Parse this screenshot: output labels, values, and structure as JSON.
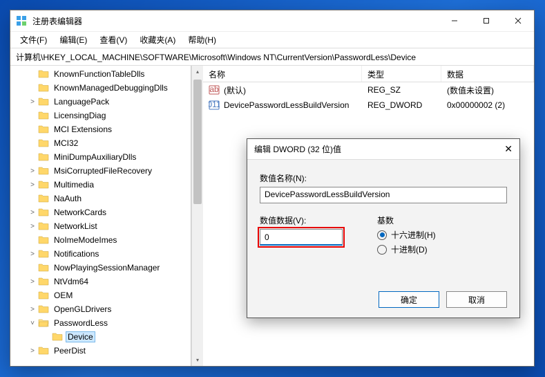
{
  "window": {
    "title": "注册表编辑器"
  },
  "menubar": {
    "items": [
      "文件(F)",
      "编辑(E)",
      "查看(V)",
      "收藏夹(A)",
      "帮助(H)"
    ]
  },
  "address": "计算机\\HKEY_LOCAL_MACHINE\\SOFTWARE\\Microsoft\\Windows NT\\CurrentVersion\\PasswordLess\\Device",
  "tree": {
    "items": [
      {
        "label": "KnownFunctionTableDlls",
        "depth": 1,
        "expander": ""
      },
      {
        "label": "KnownManagedDebuggingDlls",
        "depth": 1,
        "expander": ""
      },
      {
        "label": "LanguagePack",
        "depth": 1,
        "expander": ">"
      },
      {
        "label": "LicensingDiag",
        "depth": 1,
        "expander": ""
      },
      {
        "label": "MCI Extensions",
        "depth": 1,
        "expander": ""
      },
      {
        "label": "MCI32",
        "depth": 1,
        "expander": ""
      },
      {
        "label": "MiniDumpAuxiliaryDlls",
        "depth": 1,
        "expander": ""
      },
      {
        "label": "MsiCorruptedFileRecovery",
        "depth": 1,
        "expander": ">"
      },
      {
        "label": "Multimedia",
        "depth": 1,
        "expander": ">"
      },
      {
        "label": "NaAuth",
        "depth": 1,
        "expander": ""
      },
      {
        "label": "NetworkCards",
        "depth": 1,
        "expander": ">"
      },
      {
        "label": "NetworkList",
        "depth": 1,
        "expander": ">"
      },
      {
        "label": "NoImeModeImes",
        "depth": 1,
        "expander": ""
      },
      {
        "label": "Notifications",
        "depth": 1,
        "expander": ">"
      },
      {
        "label": "NowPlayingSessionManager",
        "depth": 1,
        "expander": ""
      },
      {
        "label": "NtVdm64",
        "depth": 1,
        "expander": ">"
      },
      {
        "label": "OEM",
        "depth": 1,
        "expander": ""
      },
      {
        "label": "OpenGLDrivers",
        "depth": 1,
        "expander": ">"
      },
      {
        "label": "PasswordLess",
        "depth": 1,
        "expander": "v",
        "expanded": true
      },
      {
        "label": "Device",
        "depth": 2,
        "expander": "",
        "selected": true
      },
      {
        "label": "PeerDist",
        "depth": 1,
        "expander": ">"
      }
    ]
  },
  "list": {
    "headers": {
      "name": "名称",
      "type": "类型",
      "data": "数据"
    },
    "rows": [
      {
        "icon": "str",
        "name": "(默认)",
        "type": "REG_SZ",
        "data": "(数值未设置)"
      },
      {
        "icon": "bin",
        "name": "DevicePasswordLessBuildVersion",
        "type": "REG_DWORD",
        "data": "0x00000002 (2)"
      }
    ]
  },
  "dialog": {
    "title": "编辑 DWORD (32 位)值",
    "name_label": "数值名称(N):",
    "name_value": "DevicePasswordLessBuildVersion",
    "data_label": "数值数据(V):",
    "data_value": "0",
    "base_label": "基数",
    "radio_hex": "十六进制(H)",
    "radio_dec": "十进制(D)",
    "ok": "确定",
    "cancel": "取消"
  }
}
